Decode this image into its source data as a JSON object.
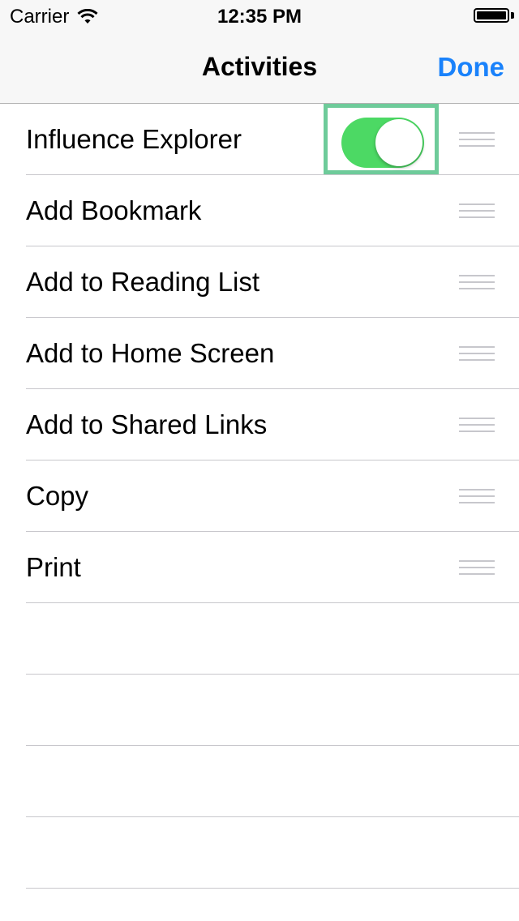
{
  "status_bar": {
    "carrier": "Carrier",
    "time": "12:35 PM",
    "signal_icon": "wifi-icon",
    "battery_icon": "battery-icon"
  },
  "nav": {
    "title": "Activities",
    "done_label": "Done"
  },
  "colors": {
    "accent": "#1a82fb",
    "toggle_on": "#4cd964",
    "highlight": "#6ecb9a"
  },
  "activities": [
    {
      "label": "Influence Explorer",
      "toggle": true,
      "toggle_on": true
    },
    {
      "label": "Add Bookmark"
    },
    {
      "label": "Add to Reading List"
    },
    {
      "label": "Add to Home Screen"
    },
    {
      "label": "Add to Shared Links"
    },
    {
      "label": "Copy"
    },
    {
      "label": "Print"
    }
  ]
}
